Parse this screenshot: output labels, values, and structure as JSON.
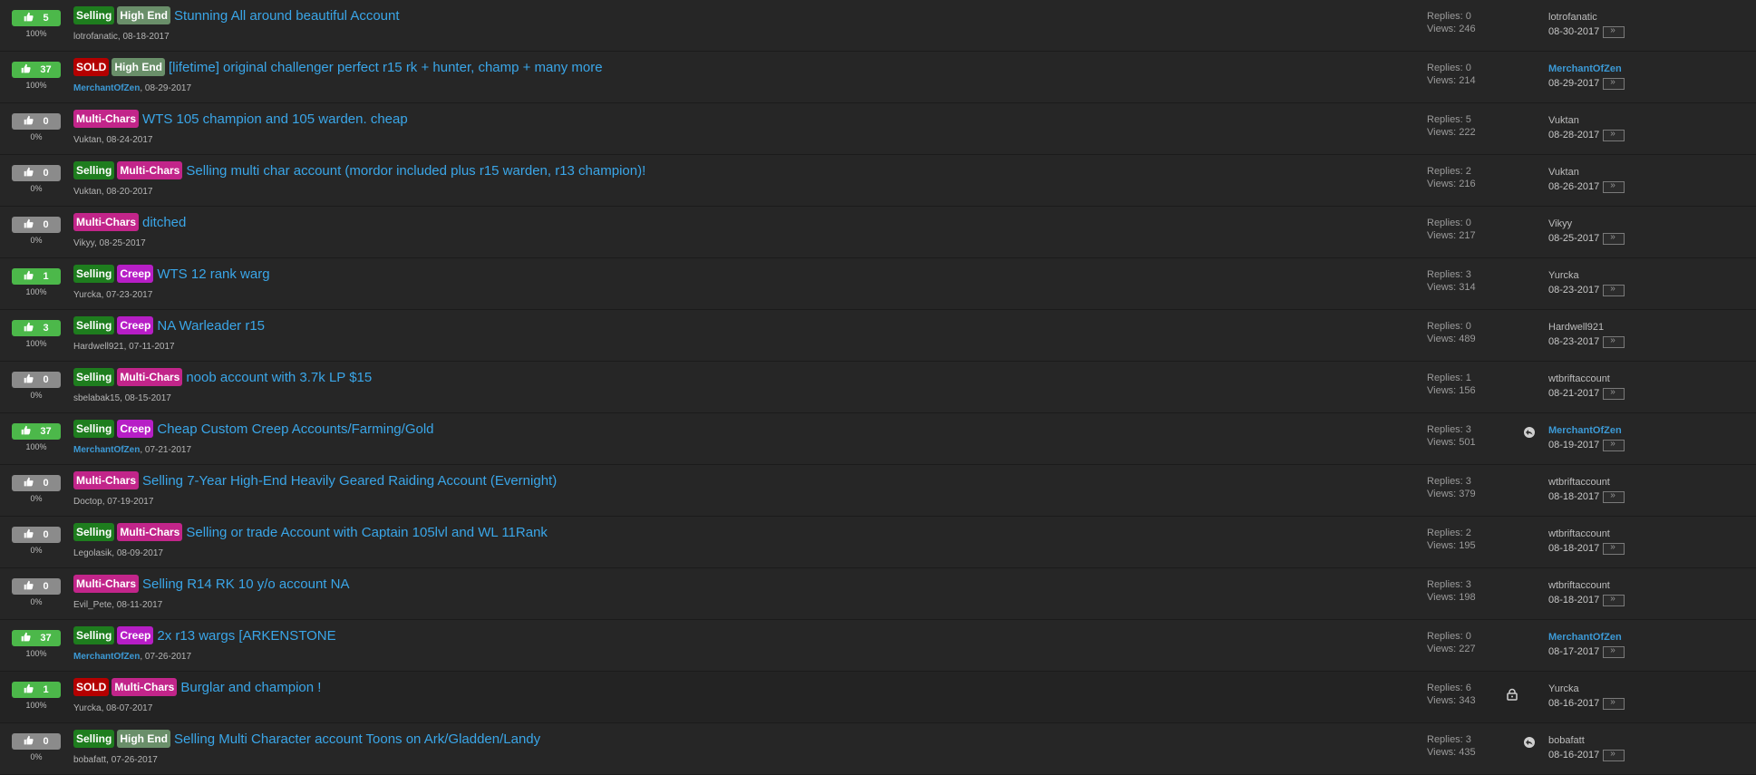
{
  "colors": {
    "background": "#262626",
    "link": "#3aa6e8",
    "rep_positive": "#4cb84a",
    "rep_zero": "#8b8b8b",
    "badge_selling": "#1e7d1e",
    "badge_highend": "#6a8f6a",
    "badge_sold": "#b40000",
    "badge_multichars": "#c2258a",
    "badge_creep": "#b71ec6"
  },
  "threads": [
    {
      "rep": "5",
      "rep_pct": "100%",
      "positive": true,
      "tags": [
        [
          "Selling",
          "selling"
        ],
        [
          "High End",
          "highend"
        ]
      ],
      "title": "Stunning All around beautiful Account",
      "author": "lotrofanatic",
      "author_zen": false,
      "date": ", 08-18-2017",
      "replies": "Replies: 0",
      "views": "Views: 246",
      "lp_user": "lotrofanatic",
      "lp_zen": false,
      "lp_date": "08-30-2017",
      "icon": ""
    },
    {
      "rep": "37",
      "rep_pct": "100%",
      "positive": true,
      "tags": [
        [
          "SOLD",
          "sold"
        ],
        [
          "High End",
          "highend"
        ]
      ],
      "title": "[lifetime] original challenger perfect r15 rk + hunter, champ + many more",
      "author": "MerchantOfZen",
      "author_zen": true,
      "date": ", 08-29-2017",
      "replies": "Replies: 0",
      "views": "Views: 214",
      "lp_user": "MerchantOfZen",
      "lp_zen": true,
      "lp_date": "08-29-2017",
      "icon": ""
    },
    {
      "rep": "0",
      "rep_pct": "0%",
      "positive": false,
      "tags": [
        [
          "Multi-Chars",
          "multi"
        ]
      ],
      "title": "WTS 105 champion and 105 warden. cheap",
      "author": "Vuktan",
      "author_zen": false,
      "date": ", 08-24-2017",
      "replies": "Replies: 5",
      "views": "Views: 222",
      "lp_user": "Vuktan",
      "lp_zen": false,
      "lp_date": "08-28-2017",
      "icon": ""
    },
    {
      "rep": "0",
      "rep_pct": "0%",
      "positive": false,
      "tags": [
        [
          "Selling",
          "selling"
        ],
        [
          "Multi-Chars",
          "multi"
        ]
      ],
      "title": "Selling multi char account (mordor included plus r15 warden, r13 champion)!",
      "author": "Vuktan",
      "author_zen": false,
      "date": ", 08-20-2017",
      "replies": "Replies: 2",
      "views": "Views: 216",
      "lp_user": "Vuktan",
      "lp_zen": false,
      "lp_date": "08-26-2017",
      "icon": ""
    },
    {
      "rep": "0",
      "rep_pct": "0%",
      "positive": false,
      "tags": [
        [
          "Multi-Chars",
          "multi"
        ]
      ],
      "title": "ditched",
      "author": "Vikyy",
      "author_zen": false,
      "date": ", 08-25-2017",
      "replies": "Replies: 0",
      "views": "Views: 217",
      "lp_user": "Vikyy",
      "lp_zen": false,
      "lp_date": "08-25-2017",
      "icon": ""
    },
    {
      "rep": "1",
      "rep_pct": "100%",
      "positive": true,
      "tags": [
        [
          "Selling",
          "selling"
        ],
        [
          "Creep",
          "creep"
        ]
      ],
      "title": "WTS 12 rank warg",
      "author": "Yurcka",
      "author_zen": false,
      "date": ", 07-23-2017",
      "replies": "Replies: 3",
      "views": "Views: 314",
      "lp_user": "Yurcka",
      "lp_zen": false,
      "lp_date": "08-23-2017",
      "icon": ""
    },
    {
      "rep": "3",
      "rep_pct": "100%",
      "positive": true,
      "tags": [
        [
          "Selling",
          "selling"
        ],
        [
          "Creep",
          "creep"
        ]
      ],
      "title": "NA Warleader r15",
      "author": "Hardwell921",
      "author_zen": false,
      "date": ", 07-11-2017",
      "replies": "Replies: 0",
      "views": "Views: 489",
      "lp_user": "Hardwell921",
      "lp_zen": false,
      "lp_date": "08-23-2017",
      "icon": ""
    },
    {
      "rep": "0",
      "rep_pct": "0%",
      "positive": false,
      "tags": [
        [
          "Selling",
          "selling"
        ],
        [
          "Multi-Chars",
          "multi"
        ]
      ],
      "title": "noob account with 3.7k LP $15",
      "author": "sbelabak15",
      "author_zen": false,
      "date": ", 08-15-2017",
      "replies": "Replies: 1",
      "views": "Views: 156",
      "lp_user": "wtbriftaccount",
      "lp_zen": false,
      "lp_date": "08-21-2017",
      "icon": ""
    },
    {
      "rep": "37",
      "rep_pct": "100%",
      "positive": true,
      "tags": [
        [
          "Selling",
          "selling"
        ],
        [
          "Creep",
          "creep"
        ]
      ],
      "title": "Cheap Custom Creep Accounts/Farming/Gold",
      "author": "MerchantOfZen",
      "author_zen": true,
      "date": ", 07-21-2017",
      "replies": "Replies: 3",
      "views": "Views: 501",
      "lp_user": "MerchantOfZen",
      "lp_zen": true,
      "lp_date": "08-19-2017",
      "icon": "reply"
    },
    {
      "rep": "0",
      "rep_pct": "0%",
      "positive": false,
      "tags": [
        [
          "Multi-Chars",
          "multi"
        ]
      ],
      "title": "Selling 7-Year High-End Heavily Geared Raiding Account (Evernight)",
      "author": "Doctop",
      "author_zen": false,
      "date": ", 07-19-2017",
      "replies": "Replies: 3",
      "views": "Views: 379",
      "lp_user": "wtbriftaccount",
      "lp_zen": false,
      "lp_date": "08-18-2017",
      "icon": ""
    },
    {
      "rep": "0",
      "rep_pct": "0%",
      "positive": false,
      "tags": [
        [
          "Selling",
          "selling"
        ],
        [
          "Multi-Chars",
          "multi"
        ]
      ],
      "title": "Selling or trade Account with Captain 105lvl and WL 11Rank",
      "author": "Legolasik",
      "author_zen": false,
      "date": ", 08-09-2017",
      "replies": "Replies: 2",
      "views": "Views: 195",
      "lp_user": "wtbriftaccount",
      "lp_zen": false,
      "lp_date": "08-18-2017",
      "icon": ""
    },
    {
      "rep": "0",
      "rep_pct": "0%",
      "positive": false,
      "tags": [
        [
          "Multi-Chars",
          "multi"
        ]
      ],
      "title": "Selling R14 RK 10 y/o account NA",
      "author": "Evil_Pete",
      "author_zen": false,
      "date": ", 08-11-2017",
      "replies": "Replies: 3",
      "views": "Views: 198",
      "lp_user": "wtbriftaccount",
      "lp_zen": false,
      "lp_date": "08-18-2017",
      "icon": ""
    },
    {
      "rep": "37",
      "rep_pct": "100%",
      "positive": true,
      "tags": [
        [
          "Selling",
          "selling"
        ],
        [
          "Creep",
          "creep"
        ]
      ],
      "title": "2x r13 wargs [ARKENSTONE",
      "author": "MerchantOfZen",
      "author_zen": true,
      "date": ", 07-26-2017",
      "replies": "Replies: 0",
      "views": "Views: 227",
      "lp_user": "MerchantOfZen",
      "lp_zen": true,
      "lp_date": "08-17-2017",
      "icon": ""
    },
    {
      "rep": "1",
      "rep_pct": "100%",
      "positive": true,
      "tags": [
        [
          "SOLD",
          "sold"
        ],
        [
          "Multi-Chars",
          "multi"
        ]
      ],
      "title": "Burglar and champion !",
      "author": "Yurcka",
      "author_zen": false,
      "date": ", 08-07-2017",
      "replies": "Replies: 6",
      "views": "Views: 343",
      "lp_user": "Yurcka",
      "lp_zen": false,
      "lp_date": "08-16-2017",
      "icon": "lock"
    },
    {
      "rep": "0",
      "rep_pct": "0%",
      "positive": false,
      "tags": [
        [
          "Selling",
          "selling"
        ],
        [
          "High End",
          "highend"
        ]
      ],
      "title": "Selling Multi Character account Toons on Ark/Gladden/Landy",
      "author": "bobafatt",
      "author_zen": false,
      "date": ", 07-26-2017",
      "replies": "Replies: 3",
      "views": "Views: 435",
      "lp_user": "bobafatt",
      "lp_zen": false,
      "lp_date": "08-16-2017",
      "icon": "reply"
    }
  ]
}
